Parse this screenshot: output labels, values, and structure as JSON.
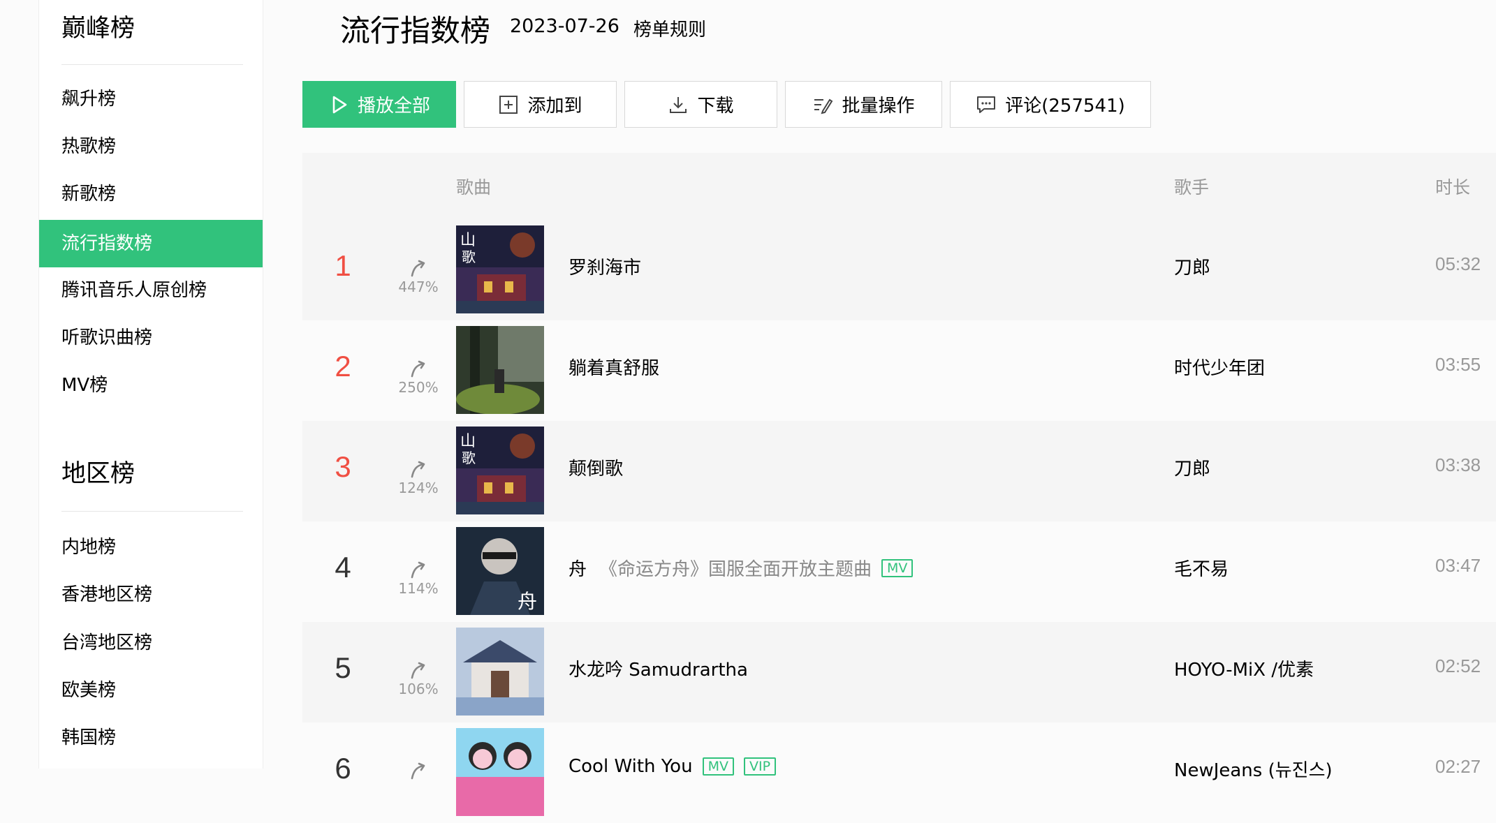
{
  "sidebar": {
    "group1_title": "巅峰榜",
    "group1_items": [
      "飙升榜",
      "热歌榜",
      "新歌榜",
      "流行指数榜",
      "腾讯音乐人原创榜",
      "听歌识曲榜",
      "MV榜"
    ],
    "group2_title": "地区榜",
    "group2_items": [
      "内地榜",
      "香港地区榜",
      "台湾地区榜",
      "欧美榜",
      "韩国榜"
    ],
    "active_item": "流行指数榜"
  },
  "header": {
    "title": "流行指数榜",
    "date": "2023-07-26",
    "rules_link": "榜单规则"
  },
  "toolbar": {
    "play_all": "播放全部",
    "add_to": "添加到",
    "download": "下载",
    "batch": "批量操作",
    "comments": "评论(257541)"
  },
  "table": {
    "headers": {
      "song": "歌曲",
      "singer": "歌手",
      "duration": "时长"
    },
    "rows": [
      {
        "rank": "1",
        "trend": "447%",
        "title": "罗刹海市",
        "subtitle": "",
        "tags": [],
        "singer": "刀郎",
        "duration": "05:32",
        "cover": "cover-shange"
      },
      {
        "rank": "2",
        "trend": "250%",
        "title": "躺着真舒服",
        "subtitle": "",
        "tags": [],
        "singer": "时代少年团",
        "duration": "03:55",
        "cover": "cover-forest"
      },
      {
        "rank": "3",
        "trend": "124%",
        "title": "颠倒歌",
        "subtitle": "",
        "tags": [],
        "singer": "刀郎",
        "duration": "03:38",
        "cover": "cover-shange"
      },
      {
        "rank": "4",
        "trend": "114%",
        "title": "舟",
        "subtitle": "《命运方舟》国服全面开放主题曲",
        "tags": [
          "MV"
        ],
        "singer": "毛不易",
        "duration": "03:47",
        "cover": "cover-zhou"
      },
      {
        "rank": "5",
        "trend": "106%",
        "title": "水龙吟 Samudrartha",
        "subtitle": "",
        "tags": [],
        "singer": "HOYO-MiX /优素",
        "duration": "02:52",
        "cover": "cover-temple"
      },
      {
        "rank": "6",
        "trend": "",
        "title": "Cool With You",
        "subtitle": "",
        "tags": [
          "MV",
          "VIP"
        ],
        "singer": "NewJeans (뉴진스)",
        "duration": "02:27",
        "cover": "cover-cartoon"
      }
    ]
  },
  "colors": {
    "accent": "#31c27c",
    "top_rank": "#f04f43",
    "muted": "#999999"
  }
}
